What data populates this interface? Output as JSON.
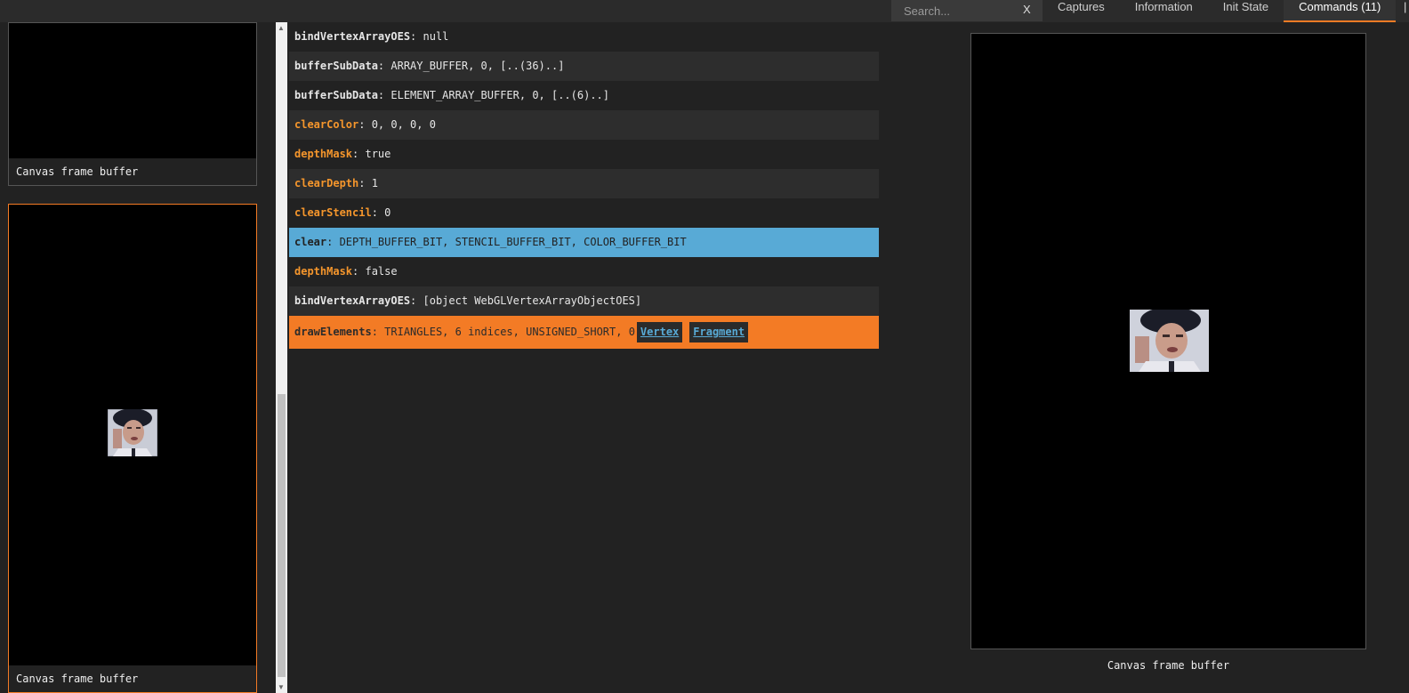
{
  "search": {
    "placeholder": "Search...",
    "clear_label": "X"
  },
  "tabs": [
    {
      "label": "Captures"
    },
    {
      "label": "Information"
    },
    {
      "label": "Init State"
    },
    {
      "label": "Commands (11)"
    }
  ],
  "tab_more": "|",
  "thumbnails": [
    {
      "caption": "Canvas frame buffer"
    },
    {
      "caption": "Canvas frame buffer"
    }
  ],
  "commands": [
    {
      "name": "bindVertexArrayOES",
      "args": ": null"
    },
    {
      "name": "bufferSubData",
      "args": ": ARRAY_BUFFER, 0, [..(36)..]"
    },
    {
      "name": "bufferSubData",
      "args": ": ELEMENT_ARRAY_BUFFER, 0, [..(6)..]"
    },
    {
      "name": "clearColor",
      "args": ": 0, 0, 0, 0"
    },
    {
      "name": "depthMask",
      "args": ": true"
    },
    {
      "name": "clearDepth",
      "args": ": 1"
    },
    {
      "name": "clearStencil",
      "args": ": 0"
    },
    {
      "name": "clear",
      "args": ": DEPTH_BUFFER_BIT, STENCIL_BUFFER_BIT, COLOR_BUFFER_BIT"
    },
    {
      "name": "depthMask",
      "args": ": false"
    },
    {
      "name": "bindVertexArrayOES",
      "args": ": [object WebGLVertexArrayObjectOES]"
    },
    {
      "name": "drawElements",
      "args": ": TRIANGLES, 6 indices, UNSIGNED_SHORT, 0",
      "vertex_label": "Vertex",
      "fragment_label": "Fragment"
    }
  ],
  "preview": {
    "caption": "Canvas frame buffer"
  },
  "colors": {
    "accent": "#f37b25",
    "highlight": "#58aad6",
    "changed": "#f5962c",
    "background": "#222222"
  }
}
